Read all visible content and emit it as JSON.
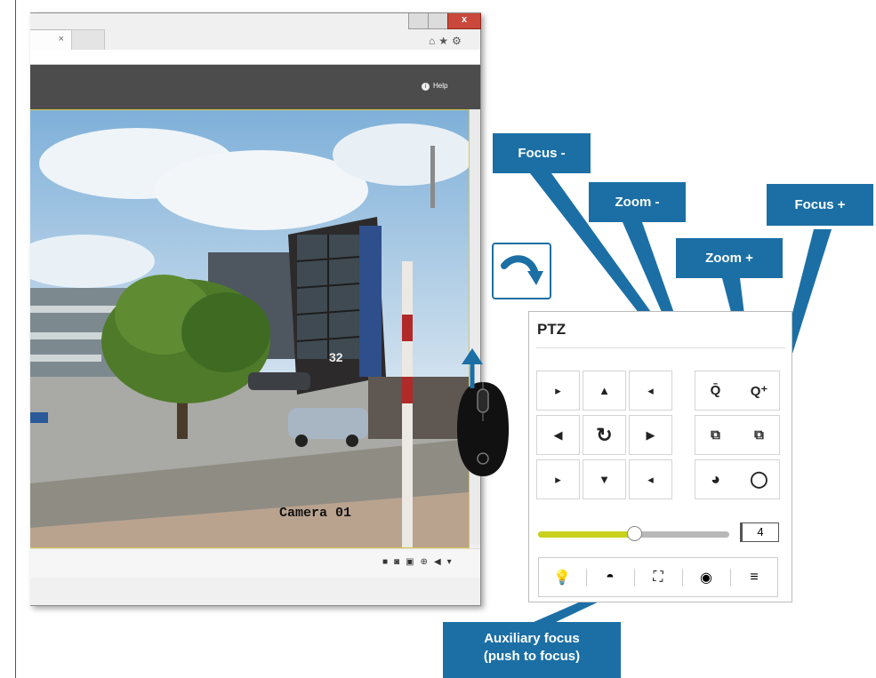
{
  "browser": {
    "tab_close": "×",
    "close_glyph": "x",
    "toolbar_icons": "⌂★⚙",
    "help_label": "Help",
    "help_icon": "i"
  },
  "video": {
    "camera_label": "Camera 01",
    "building_number": "32",
    "toolbar_icons": [
      "stop-icon",
      "snapshot-icon",
      "record-icon",
      "zoom-icon",
      "audio-icon"
    ]
  },
  "ptz": {
    "title": "PTZ",
    "speed_value": "4",
    "speed_fraction": 0.5,
    "menu_icon": "≡"
  },
  "callouts": {
    "focus_minus": "Focus -",
    "zoom_minus": "Zoom -",
    "focus_plus": "Focus +",
    "zoom_plus": "Zoom +",
    "aux_focus_line1": "Auxiliary focus",
    "aux_focus_line2": "(push to focus)"
  },
  "colors": {
    "callout_blue": "#1b6fa5",
    "slider_yellow": "#c9d21a",
    "app_bar": "#4c4c4c"
  }
}
